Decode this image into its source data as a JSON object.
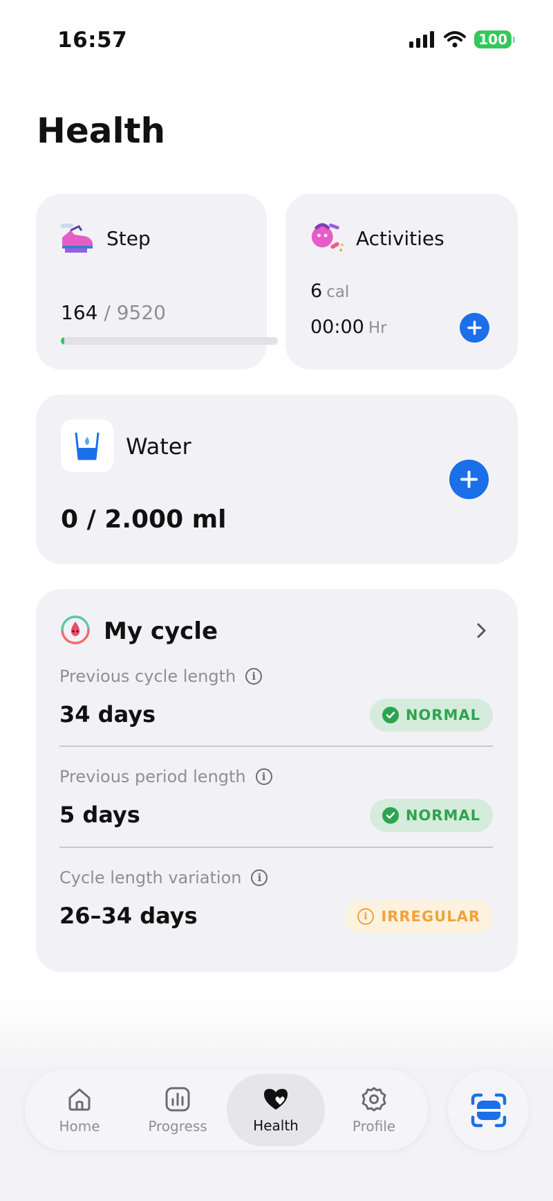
{
  "status": {
    "time": "16:57",
    "battery": "100"
  },
  "page": {
    "title": "Health"
  },
  "step": {
    "label": "Step",
    "current": "164",
    "separator": " / ",
    "goal": "9520",
    "progress": 0.017
  },
  "activities": {
    "label": "Activities",
    "calories": "6",
    "calories_unit": "cal",
    "duration": "00:00",
    "duration_unit": "Hr"
  },
  "water": {
    "label": "Water",
    "value": "0 / 2.000 ml"
  },
  "cycle": {
    "title": "My cycle",
    "rows": [
      {
        "label": "Previous cycle length",
        "value": "34 days",
        "status": "NORMAL"
      },
      {
        "label": "Previous period length",
        "value": "5 days",
        "status": "NORMAL"
      },
      {
        "label": "Cycle length variation",
        "value": "26–34 days",
        "status": "IRREGULAR"
      }
    ]
  },
  "colors": {
    "accent": "#1b6fe8",
    "normal": "#2da44e",
    "irregular": "#f2a23a",
    "card": "#f2f2f6"
  },
  "nav": {
    "items": [
      {
        "label": "Home",
        "icon": "home-icon"
      },
      {
        "label": "Progress",
        "icon": "chart-icon"
      },
      {
        "label": "Health",
        "icon": "heart-icon",
        "active": true
      },
      {
        "label": "Profile",
        "icon": "gear-icon"
      }
    ],
    "scan_icon": "scan-icon"
  }
}
